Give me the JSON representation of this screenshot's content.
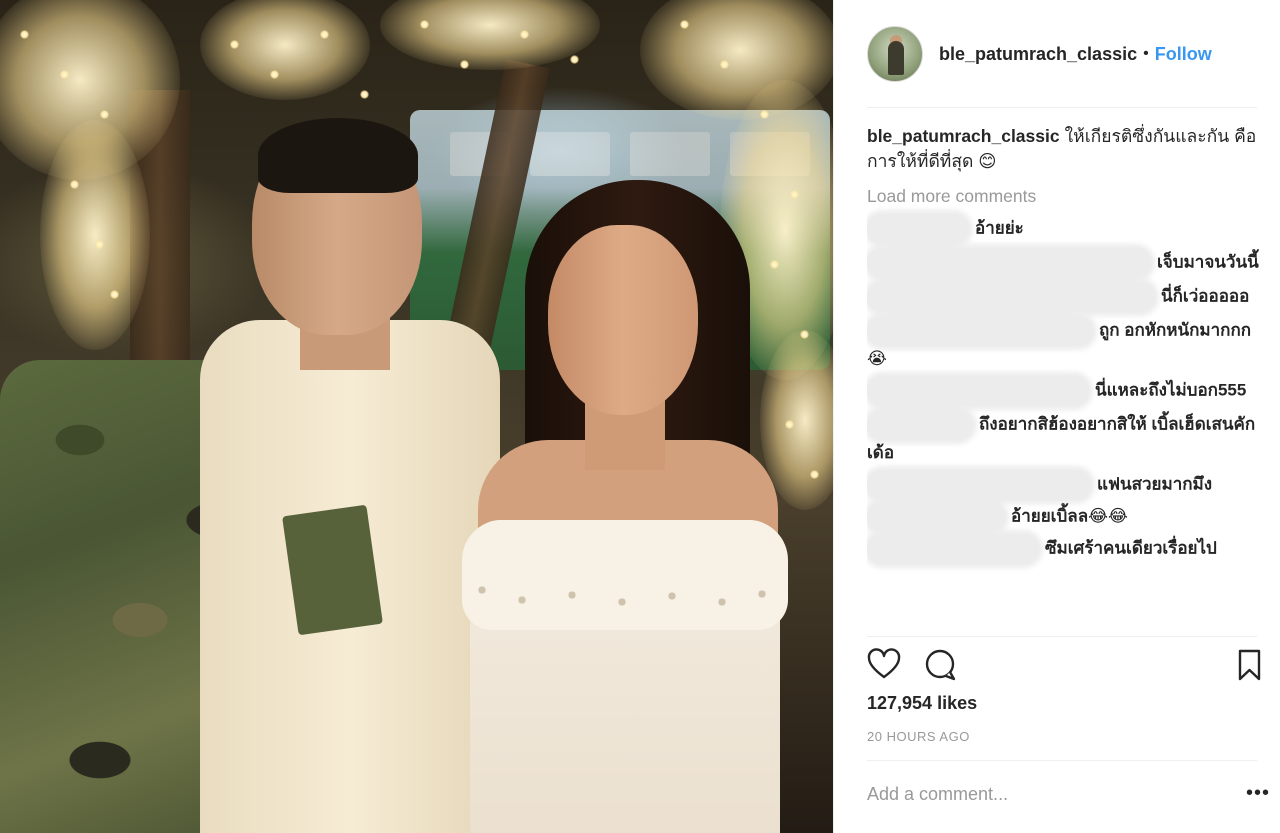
{
  "post": {
    "username": "ble_patumrach_classic",
    "separator": "•",
    "follow_label": "Follow",
    "caption_user": "ble_patumrach_classic",
    "caption_text": "ให้เกียรติซึ่งกันและกัน คือการให้ที่ดีที่สุด 😊",
    "load_more_label": "Load more comments",
    "comments": [
      {
        "text": "อ้ายย่ะ"
      },
      {
        "text": "เจ็บมาจนวันนี้"
      },
      {
        "text": "นี่ก็เว่อออออ"
      },
      {
        "text": "ถูก อกหักหนักมากกก😭"
      },
      {
        "text": "นี่แหละถึงไม่บอก555"
      },
      {
        "text": "ถึงอยากสิฮ้องอยากสิให้ เบิ้ลเฮ็ดเสนคักเด้อ"
      },
      {
        "text": "แฟนสวยมากมึง"
      },
      {
        "text": "อ้ายยเบิ้ลล😂😂"
      },
      {
        "text": "ซึมเศร้าคนเดียวเรื่อยไป"
      }
    ],
    "likes": "127,954 likes",
    "time": "20 HOURS AGO",
    "add_comment_placeholder": "Add a comment...",
    "more_label": "•••"
  },
  "icons": {
    "like": "heart-icon",
    "comment": "speech-bubble-icon",
    "save": "bookmark-icon"
  },
  "colors": {
    "accent": "#3897f0",
    "text": "#262626",
    "muted": "#999999",
    "divider": "#efefef"
  }
}
